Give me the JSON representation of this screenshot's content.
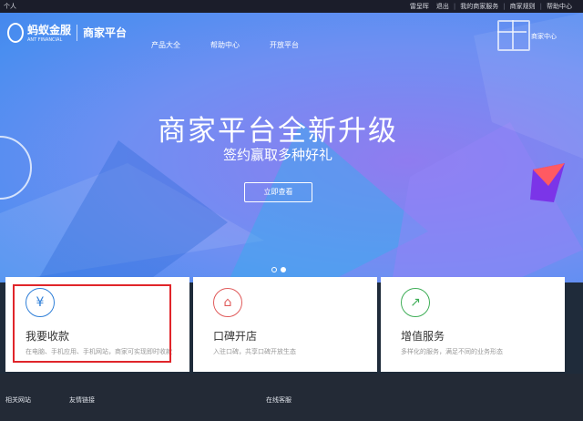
{
  "topbar": {
    "left_text": "个人",
    "user": "雷呈晖",
    "logout": "退出",
    "my_services": "我的商家服务",
    "rules": "商家规则",
    "help": "帮助中心"
  },
  "header": {
    "logo_brand": "蚂蚁金服",
    "logo_sub": "ANT FINANCIAL",
    "platform": "商家平台",
    "nav": [
      "产品大全",
      "帮助中心",
      "开放平台"
    ],
    "merchant_center": "商家中心"
  },
  "banner": {
    "headline": "商家平台全新升级",
    "subline": "签约赢取多种好礼",
    "cta": "立即查看",
    "active_slide": 2,
    "slide_count": 2
  },
  "cards": [
    {
      "title": "我要收款",
      "desc": "在电脑、手机应用、手机网站，商家可实现即时收款",
      "icon": "yen-download-icon",
      "color": "#2f7fd8"
    },
    {
      "title": "口碑开店",
      "desc": "入驻口碑，共享口碑开放生态",
      "icon": "shop-bag-icon",
      "color": "#e05a5a"
    },
    {
      "title": "增值服务",
      "desc": "多样化的服务，满足不同的业务形态",
      "icon": "chart-up-icon",
      "color": "#3fae57"
    }
  ],
  "footer": {
    "related": "相关网站",
    "friends": "友情链接",
    "online": "在线客服"
  },
  "colors": {
    "accent_blue": "#3a78e7",
    "highlight_red": "#e0252a"
  }
}
